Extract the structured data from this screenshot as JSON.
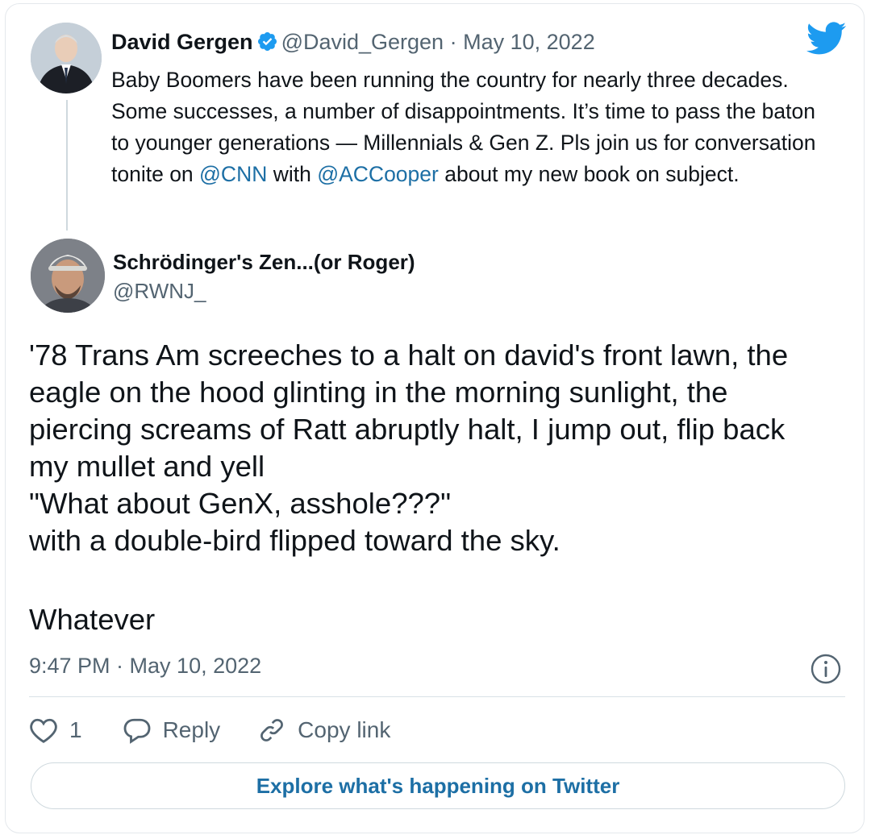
{
  "parent_tweet": {
    "author_name": "David Gergen",
    "handle": "@David_Gergen",
    "separator": "·",
    "date": "May 10, 2022",
    "text_segments": [
      "Baby Boomers have been running the country for nearly three decades.  Some successes, a number of disappointments.  It’s time to pass the baton to younger generations — Millennials & Gen Z.  Pls join us for conversation tonite on ",
      "@CNN",
      " with ",
      "@ACCooper",
      " about my new book on subject."
    ],
    "avatar_icon": "avatar-david-gergen",
    "verified_icon": "verified-badge-icon"
  },
  "reply_tweet": {
    "author_name": "Schrödinger's Zen...(or Roger)",
    "handle": "@RWNJ_",
    "avatar_icon": "avatar-roger",
    "text_lines": [
      "'78 Trans Am screeches to a halt on david's front lawn, the",
      "eagle on the hood glinting in the morning sunlight, the",
      "piercing screams of Ratt abruptly halt, I jump out, flip back",
      "my mullet and yell",
      "\"What about GenX, asshole???\"",
      "with a double-bird flipped toward the sky."
    ],
    "closing": "Whatever",
    "timestamp": "9:47 PM · May 10, 2022"
  },
  "actions": {
    "like_count": "1",
    "reply_label": "Reply",
    "copy_link_label": "Copy link"
  },
  "explore_button": "Explore what's happening on Twitter",
  "colors": {
    "link": "#1d6fa5",
    "twitter_blue": "#1d9bf0",
    "muted": "#536471",
    "text": "#0f1419"
  },
  "icons": [
    "twitter-logo-icon",
    "info-icon",
    "heart-icon",
    "reply-bubble-icon",
    "link-icon"
  ]
}
